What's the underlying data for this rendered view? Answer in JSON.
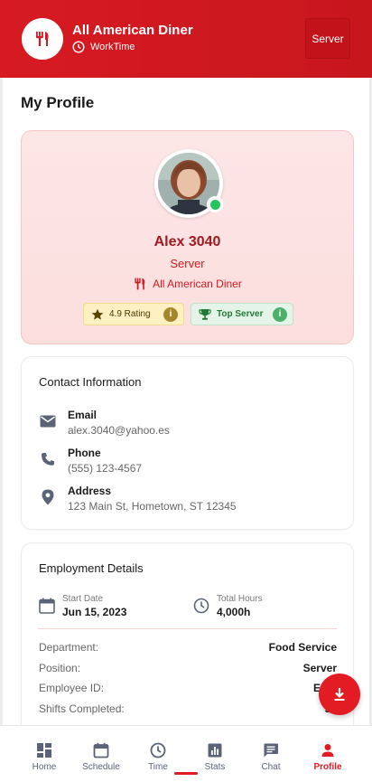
{
  "header": {
    "app_title": "All American Diner",
    "subtitle": "WorkTime",
    "role_button": "Server",
    "brand_color": "#d71a22"
  },
  "page": {
    "title": "My Profile"
  },
  "profile": {
    "name": "Alex 3040",
    "role": "Server",
    "organization": "All American Diner",
    "status": "online",
    "badges": [
      {
        "label": "4.9 Rating",
        "icon": "star-icon"
      },
      {
        "label": "Top Server",
        "icon": "trophy-icon"
      }
    ]
  },
  "contact": {
    "title": "Contact Information",
    "items": [
      {
        "label": "Email",
        "value": "alex.3040@yahoo.es",
        "icon": "mail-icon"
      },
      {
        "label": "Phone",
        "value": "(555) 123-4567",
        "icon": "phone-icon"
      },
      {
        "label": "Address",
        "value": "123 Main St, Hometown, ST 12345",
        "icon": "location-pin-icon"
      }
    ]
  },
  "employment": {
    "title": "Employment Details",
    "start_date_label": "Start Date",
    "start_date": "Jun 15, 2023",
    "total_hours_label": "Total Hours",
    "total_hours": "4,000h",
    "rows": [
      {
        "key": "Department:",
        "value": "Food Service"
      },
      {
        "key": "Position:",
        "value": "Server"
      },
      {
        "key": "Employee ID:",
        "value": "EMP"
      },
      {
        "key": "Shifts Completed:",
        "value": "50"
      }
    ]
  },
  "fab": {
    "icon": "download-icon"
  },
  "nav": {
    "items": [
      {
        "label": "Home",
        "icon": "dashboard-icon"
      },
      {
        "label": "Schedule",
        "icon": "calendar-icon"
      },
      {
        "label": "Time",
        "icon": "clock-icon"
      },
      {
        "label": "Stats",
        "icon": "bar-chart-icon"
      },
      {
        "label": "Chat",
        "icon": "chat-icon"
      },
      {
        "label": "Profile",
        "icon": "person-icon"
      }
    ],
    "active": "Profile"
  }
}
